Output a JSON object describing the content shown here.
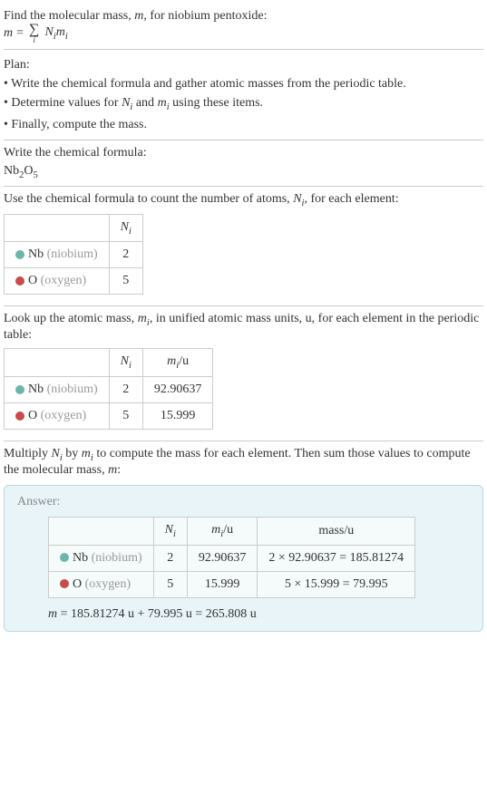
{
  "intro": {
    "line1_prefix": "Find the molecular mass, ",
    "line1_var": "m",
    "line1_suffix": ", for niobium pentoxide:",
    "eq_lhs_var": "m",
    "eq_equals": " = ",
    "eq_sigma": "∑",
    "eq_sigma_sub": "i",
    "eq_rhs_n": "N",
    "eq_rhs_n_sub": "i",
    "eq_rhs_m": "m",
    "eq_rhs_m_sub": "i"
  },
  "plan": {
    "heading": "Plan:",
    "bullet1": "• Write the chemical formula and gather atomic masses from the periodic table.",
    "bullet2_prefix": "• Determine values for ",
    "bullet2_n": "N",
    "bullet2_n_sub": "i",
    "bullet2_and": " and ",
    "bullet2_m": "m",
    "bullet2_m_sub": "i",
    "bullet2_suffix": " using these items.",
    "bullet3": "• Finally, compute the mass."
  },
  "formula_section": {
    "heading": "Write the chemical formula:",
    "nb": "Nb",
    "nb_sub": "2",
    "o": "O",
    "o_sub": "5"
  },
  "count_section": {
    "heading_prefix": "Use the chemical formula to count the number of atoms, ",
    "heading_n": "N",
    "heading_n_sub": "i",
    "heading_suffix": ", for each element:",
    "col_n": "N",
    "col_n_sub": "i",
    "nb_symbol": "Nb",
    "nb_name": " (niobium)",
    "o_symbol": "O",
    "o_name": " (oxygen)",
    "nb_count": "2",
    "o_count": "5"
  },
  "mass_section": {
    "heading_prefix": "Look up the atomic mass, ",
    "heading_m": "m",
    "heading_m_sub": "i",
    "heading_suffix": ", in unified atomic mass units, u, for each element in the periodic table:",
    "col_n": "N",
    "col_n_sub": "i",
    "col_m": "m",
    "col_m_sub": "i",
    "col_m_unit": "/u",
    "nb_symbol": "Nb",
    "nb_name": " (niobium)",
    "o_symbol": "O",
    "o_name": " (oxygen)",
    "nb_count": "2",
    "nb_mass": "92.90637",
    "o_count": "5",
    "o_mass": "15.999"
  },
  "result_section": {
    "heading_prefix": "Multiply ",
    "heading_n": "N",
    "heading_n_sub": "i",
    "heading_by": " by ",
    "heading_m": "m",
    "heading_m_sub": "i",
    "heading_mid": " to compute the mass for each element. Then sum those values to compute the molecular mass, ",
    "heading_var": "m",
    "heading_suffix": ":",
    "answer_label": "Answer:",
    "col_n": "N",
    "col_n_sub": "i",
    "col_m": "m",
    "col_m_sub": "i",
    "col_m_unit": "/u",
    "col_mass": "mass/u",
    "nb_symbol": "Nb",
    "nb_name": " (niobium)",
    "o_symbol": "O",
    "o_name": " (oxygen)",
    "nb_count": "2",
    "nb_mass": "92.90637",
    "nb_calc": "2 × 92.90637 = 185.81274",
    "o_count": "5",
    "o_mass": "15.999",
    "o_calc": "5 × 15.999 = 79.995",
    "final_var": "m",
    "final_eq": " = 185.81274 u + 79.995 u = 265.808 u"
  },
  "chart_data": {
    "type": "table",
    "title": "Molecular mass of niobium pentoxide (Nb2O5)",
    "rows": [
      {
        "element": "Nb (niobium)",
        "N_i": 2,
        "m_i_u": 92.90637,
        "mass_u": 185.81274
      },
      {
        "element": "O (oxygen)",
        "N_i": 5,
        "m_i_u": 15.999,
        "mass_u": 79.995
      }
    ],
    "total_mass_u": 265.808
  }
}
